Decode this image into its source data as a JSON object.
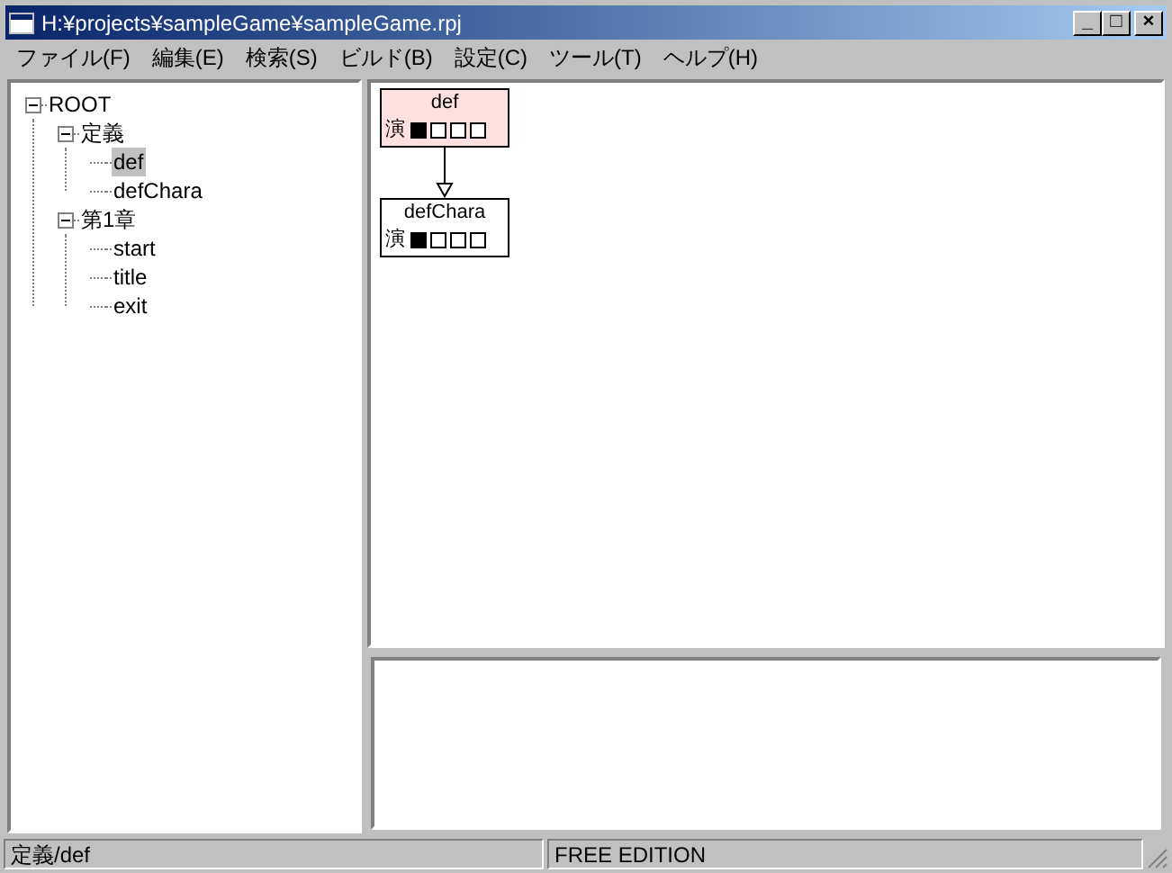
{
  "window": {
    "title": "H:¥projects¥sampleGame¥sampleGame.rpj",
    "controls": [
      "_",
      "□",
      "×"
    ]
  },
  "menu": [
    {
      "label": "ファイル(F)"
    },
    {
      "label": "編集(E)"
    },
    {
      "label": "検索(S)"
    },
    {
      "label": "ビルド(B)"
    },
    {
      "label": "設定(C)"
    },
    {
      "label": "ツール(T)"
    },
    {
      "label": "ヘルプ(H)"
    }
  ],
  "tree": [
    {
      "label": "ROOT",
      "expanded": true,
      "selected": false,
      "children": [
        {
          "label": "定義",
          "expanded": true,
          "selected": false,
          "children": [
            {
              "label": "def",
              "selected": true
            },
            {
              "label": "defChara",
              "selected": false
            }
          ]
        },
        {
          "label": "第1章",
          "expanded": true,
          "selected": false,
          "children": [
            {
              "label": "start",
              "selected": false
            },
            {
              "label": "title",
              "selected": false
            },
            {
              "label": "exit",
              "selected": false
            }
          ]
        }
      ]
    }
  ],
  "graph": {
    "nodes": [
      {
        "label": "def",
        "highlighted": true,
        "tag": "演",
        "flags": [
          true,
          false,
          false,
          false
        ]
      },
      {
        "label": "defChara",
        "highlighted": false,
        "tag": "演",
        "flags": [
          true,
          false,
          false,
          false
        ]
      }
    ]
  },
  "status_bar": [
    "定義/def",
    "FREE EDITION"
  ]
}
